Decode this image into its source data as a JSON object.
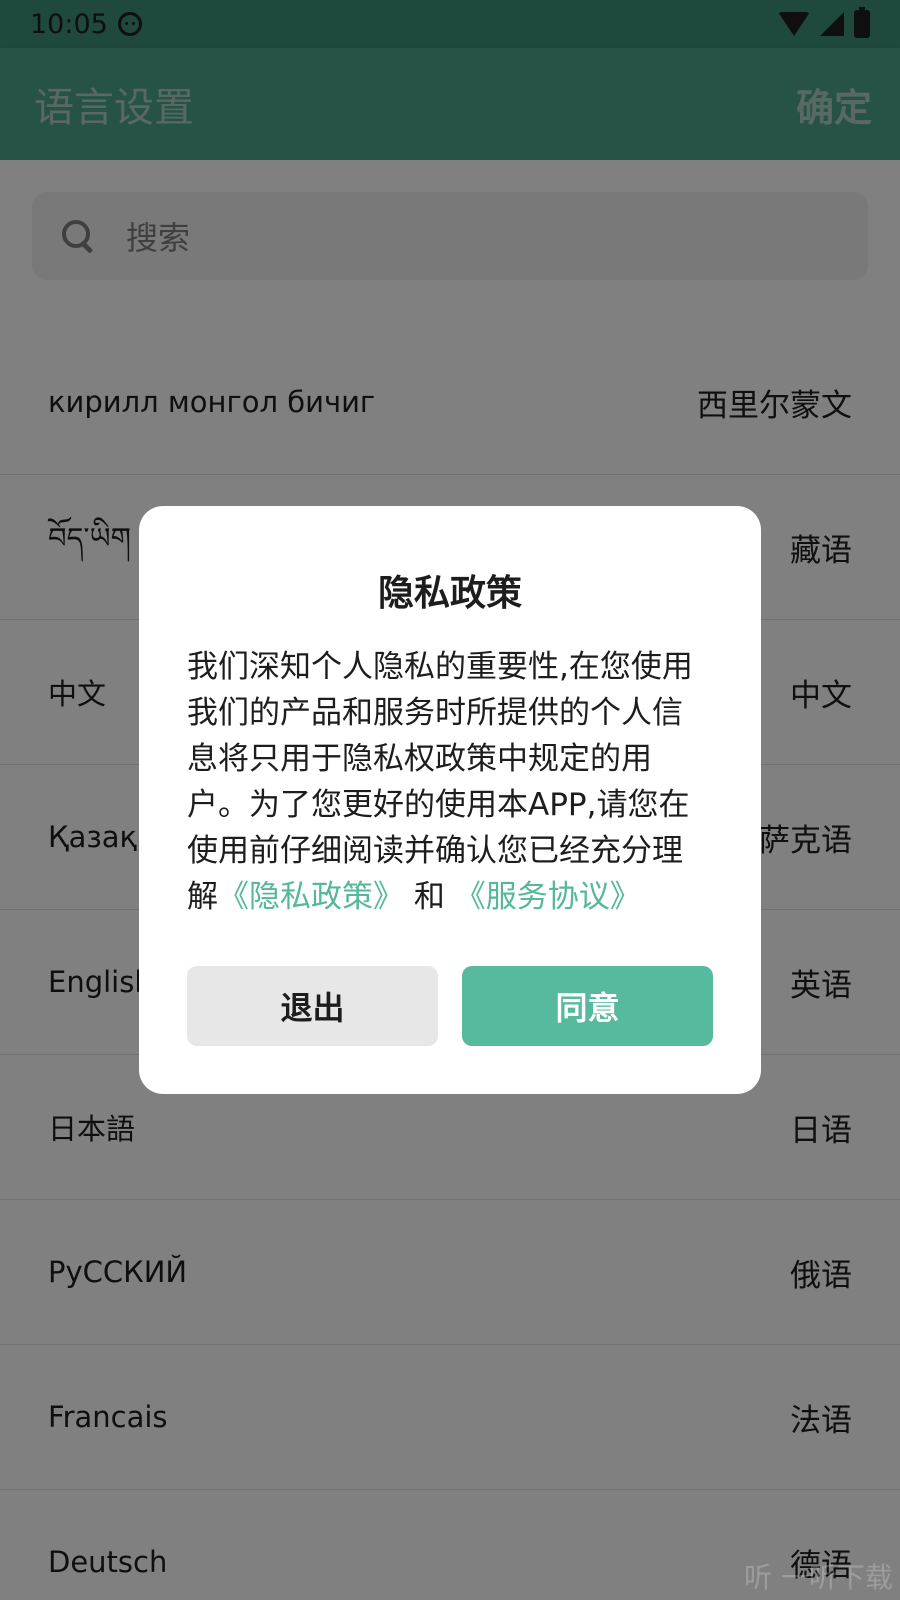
{
  "status_bar": {
    "time": "10:05"
  },
  "app_bar": {
    "title": "语言设置",
    "confirm_label": "确定"
  },
  "search": {
    "placeholder": "搜索"
  },
  "languages": [
    {
      "native": "кирилл монгол бичиг",
      "chinese": "西里尔蒙文"
    },
    {
      "native": "བོད་ཡིག",
      "chinese": "藏语"
    },
    {
      "native": "中文",
      "chinese": "中文"
    },
    {
      "native": "Қазақ",
      "chinese": "哈萨克语"
    },
    {
      "native": "English",
      "chinese": "英语"
    },
    {
      "native": "日本語",
      "chinese": "日语"
    },
    {
      "native": "РуССКИЙ",
      "chinese": "俄语"
    },
    {
      "native": "Francais",
      "chinese": "法语"
    },
    {
      "native": "Deutsch",
      "chinese": "德语"
    }
  ],
  "dialog": {
    "title": "隐私政策",
    "body": "我们深知个人隐私的重要性,在您使用我们的产品和服务时所提供的个人信息将只用于隐私权政策中规定的用户。为了您更好的使用本APP,请您在使用前仔细阅读并确认您已经充分理解",
    "privacy_link": "《隐私政策》",
    "conjunction": " 和 ",
    "service_link": "《服务协议》",
    "exit_label": "退出",
    "agree_label": "同意"
  },
  "watermark": "听 一听下载",
  "colors": {
    "primary": "#4a9f86",
    "status_bar": "#3e8d76",
    "accent": "#57b99d",
    "link": "#55b89c"
  }
}
